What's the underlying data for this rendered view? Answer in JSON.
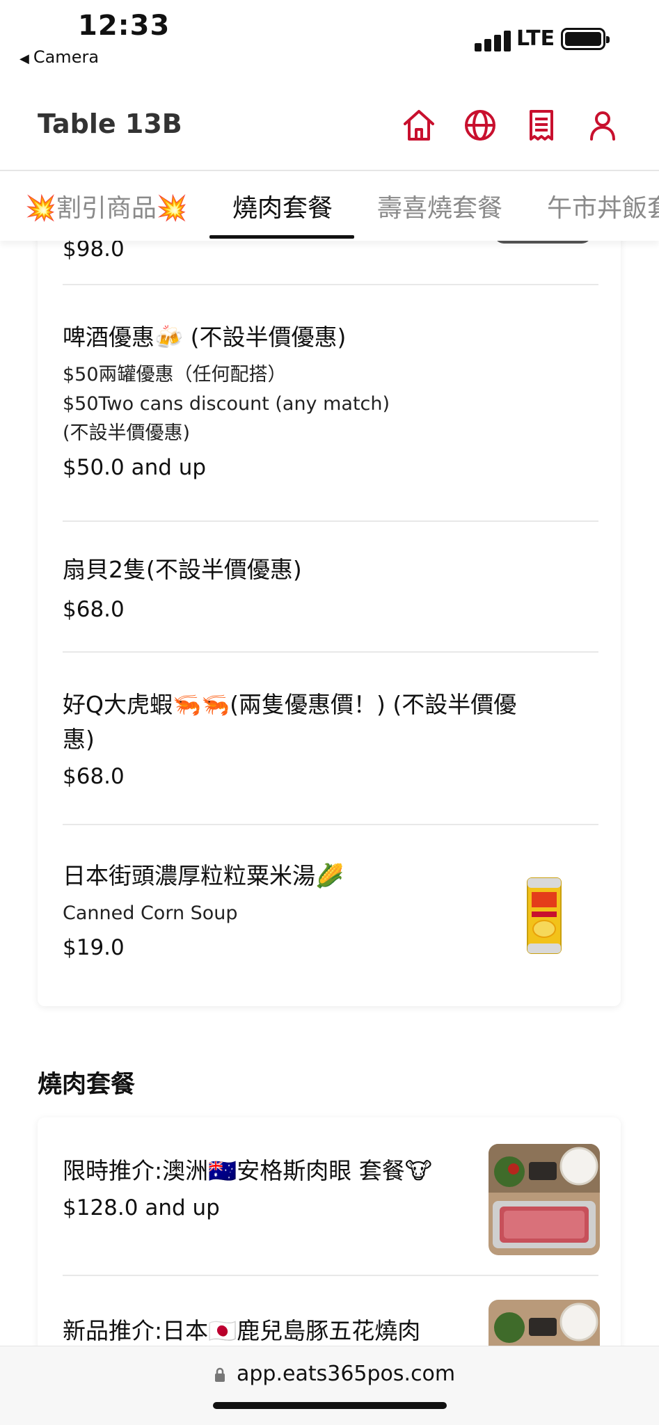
{
  "status_bar": {
    "time": "12:33",
    "back_label": "Camera",
    "network": "LTE"
  },
  "header": {
    "title": "Table 13B",
    "accent": "#c8102e",
    "icons": [
      "home-icon",
      "globe-icon",
      "receipt-icon",
      "user-icon"
    ]
  },
  "tabs": [
    {
      "label": "💥割引商品💥"
    },
    {
      "label": "燒肉套餐"
    },
    {
      "label": "壽喜燒套餐"
    },
    {
      "label": "午市丼飯套"
    }
  ],
  "top_card": {
    "partial_price": "$98.0",
    "items": [
      {
        "name": "啤酒優惠🍻 (不設半價優惠)",
        "desc1": "$50兩罐優惠（任何配搭）",
        "desc2": "$50Two cans discount (any match)",
        "desc3": "(不設半價優惠)",
        "price": "$50.0 and up"
      },
      {
        "name": "扇貝2隻(不設半價優惠)",
        "price": "$68.0"
      },
      {
        "name_line1": "好Q大虎蝦🦐🦐(兩隻優惠價！) (不設半價優",
        "name_line2": "惠)",
        "price": "$68.0"
      },
      {
        "name": "日本街頭濃厚粒粒粟米湯🌽",
        "desc1": "Canned Corn Soup",
        "price": "$19.0"
      }
    ]
  },
  "section": {
    "title": "燒肉套餐"
  },
  "set_card": {
    "items": [
      {
        "name": "限時推介:澳洲🇦🇺安格斯肉眼 套餐🐮",
        "price": "$128.0 and up"
      },
      {
        "name": "新品推介:日本🇯🇵鹿兒島豚五花燒肉"
      }
    ]
  },
  "url_bar": {
    "url": "app.eats365pos.com"
  }
}
